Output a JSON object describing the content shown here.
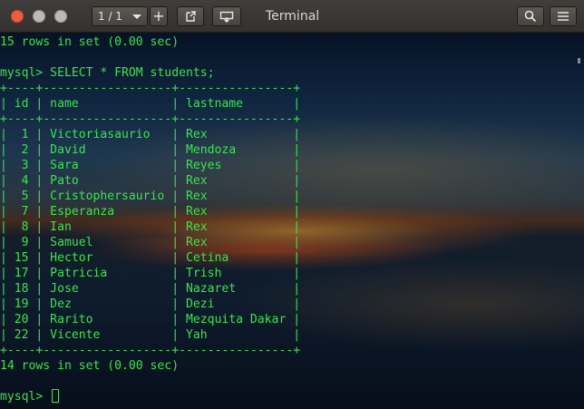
{
  "window": {
    "title": "Terminal",
    "tab_indicator": "1 / 1",
    "new_tab_label": "+",
    "colors": {
      "close": "#f05b3c",
      "text": "#33e84a",
      "titlebar": "#3a3935"
    }
  },
  "icons": {
    "export": "export-icon",
    "detach": "detach-icon",
    "search": "search-icon",
    "menu": "hamburger-menu-icon"
  },
  "terminal": {
    "lines": [
      "15 rows in set (0.00 sec)",
      "",
      "mysql> SELECT * FROM students;",
      "+----+------------------+----------------+",
      "| id | name             | lastname       |",
      "+----+------------------+----------------+",
      "|  1 | Victoriasaurio   | Rex            |",
      "|  2 | David            | Mendoza        |",
      "|  3 | Sara             | Reyes          |",
      "|  4 | Pato             | Rex            |",
      "|  5 | Cristophersaurio | Rex            |",
      "|  7 | Esperanza        | Rex            |",
      "|  8 | Ian              | Rex            |",
      "|  9 | Samuel           | Rex            |",
      "| 15 | Hector           | Cetina         |",
      "| 17 | Patricia         | Trish          |",
      "| 18 | Jose             | Nazaret        |",
      "| 19 | Dez              | Dezi           |",
      "| 20 | Rarito           | Mezquita Dakar |",
      "| 22 | Vicente          | Yah            |",
      "+----+------------------+----------------+",
      "14 rows in set (0.00 sec)",
      ""
    ],
    "prompt": "mysql> "
  }
}
